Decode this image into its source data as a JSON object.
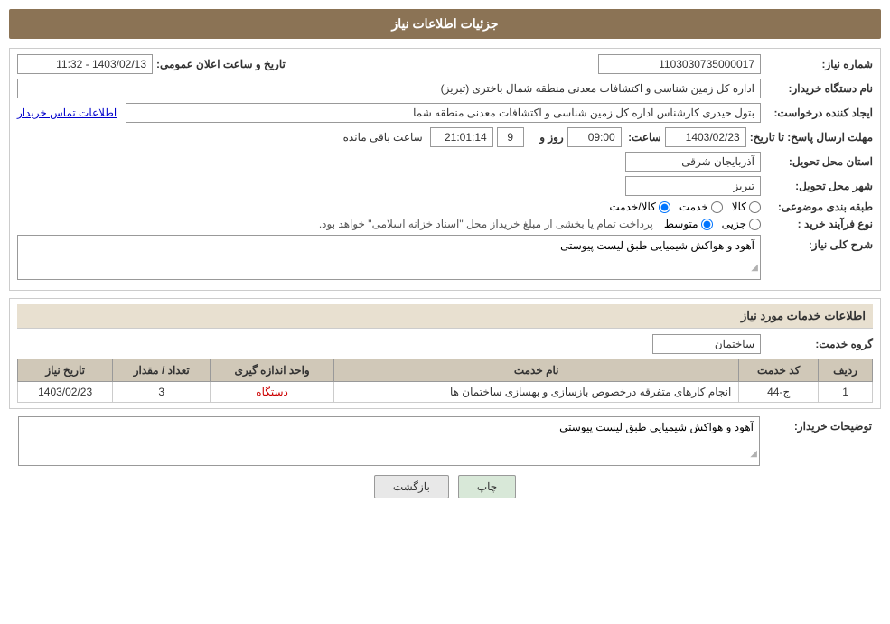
{
  "page": {
    "title": "جزئیات اطلاعات نیاز",
    "header": {
      "label": "جزئیات اطلاعات نیاز"
    }
  },
  "fields": {
    "shomareNiaz_label": "شماره نیاز:",
    "shomareNiaz_value": "1103030735000017",
    "tarikh_label": "تاریخ و ساعت اعلان عمومی:",
    "tarikh_value": "1403/02/13 - 11:32",
    "namDastgah_label": "نام دستگاه خریدار:",
    "namDastgah_value": "اداره کل زمین شناسی و اکتشافات معدنی منطقه شمال باختری (تبریز)",
    "ijadKonande_label": "ایجاد کننده درخواست:",
    "ijadKonande_value": "بتول  حیدری کارشناس اداره کل زمین شناسی و اکتشافات معدنی منطقه شما",
    "ijadKonande_link": "اطلاعات تماس خریدار",
    "mohlat_label": "مهلت ارسال پاسخ: تا تاریخ:",
    "mohlat_date": "1403/02/23",
    "mohlat_saat_label": "ساعت:",
    "mohlat_saat": "09:00",
    "mohlat_roz_label": "روز و",
    "mohlat_roz": "9",
    "mohlat_baqi": "21:01:14",
    "mohlat_baqi_label": "ساعت باقی مانده",
    "ostan_label": "استان محل تحویل:",
    "ostan_value": "آذربایجان شرقی",
    "shahr_label": "شهر محل تحویل:",
    "shahr_value": "تبریز",
    "tabaghebandi_label": "طبقه بندی موضوعی:",
    "radio_kala": "کالا",
    "radio_khadamat": "خدمت",
    "radio_kala_khadamat": "کالا/خدمت",
    "naveFarayand_label": "نوع فرآیند خرید :",
    "radio_jozvi": "جزیی",
    "radio_mottasat": "متوسط",
    "naveFarayand_desc": "پرداخت تمام یا بخشی از مبلغ خریداز محل \"اسناد خزانه اسلامی\" خواهد بود.",
    "sharh_label": "شرح کلی نیاز:",
    "sharh_value": "آهود و هواکش شیمیایی طبق لیست پیوستی",
    "info_section_title": "اطلاعات خدمات مورد نیاز",
    "grohe_khadamat_label": "گروه خدمت:",
    "grohe_khadamat_value": "ساختمان",
    "table": {
      "headers": [
        "ردیف",
        "کد خدمت",
        "نام خدمت",
        "واحد اندازه گیری",
        "تعداد / مقدار",
        "تاریخ نیاز"
      ],
      "rows": [
        {
          "radif": "1",
          "kod": "ج-44",
          "nam": "انجام کارهای متفرقه درخصوص بازسازی و بهسازی ساختمان ها",
          "vahed": "دستگاه",
          "tedad": "3",
          "tarikh": "1403/02/23"
        }
      ]
    },
    "tozihat_label": "توضیحات خریدار:",
    "tozihat_value": "آهود و هواکش شیمیایی طبق لیست پیوستی",
    "btn_chap": "چاپ",
    "btn_bazgasht": "بازگشت"
  }
}
